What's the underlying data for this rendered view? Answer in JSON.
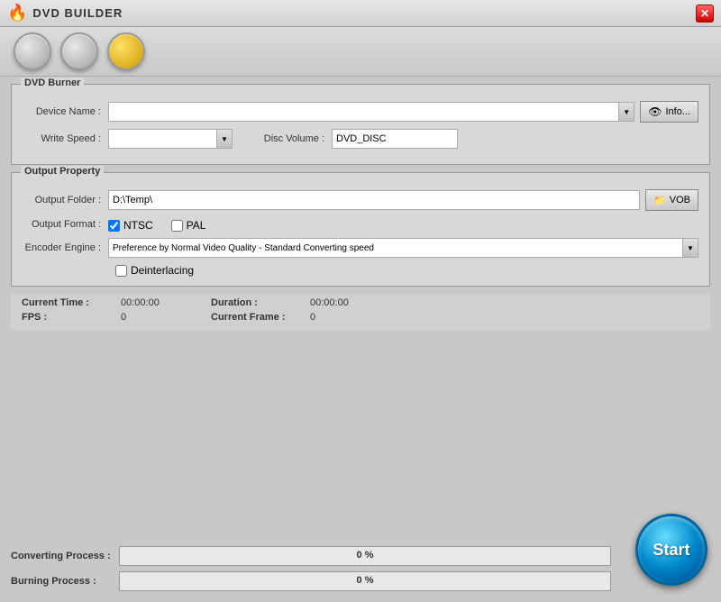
{
  "titleBar": {
    "title": "DVD BUILDER",
    "closeLabel": "✕"
  },
  "toolbar": {
    "btn1": "circle1",
    "btn2": "circle2",
    "btn3": "circle3"
  },
  "dvdBurner": {
    "groupTitle": "DVD Burner",
    "deviceNameLabel": "Device Name :",
    "deviceNameValue": "",
    "infoButtonLabel": "Info...",
    "writeSpeedLabel": "Write Speed :",
    "writeSpeedValue": "",
    "discVolumeLabel": "Disc Volume :",
    "discVolumeValue": "DVD_DISC"
  },
  "outputProperty": {
    "groupTitle": "Output Property",
    "outputFolderLabel": "Output Folder :",
    "outputFolderValue": "D:\\Temp\\",
    "vobButtonLabel": "VOB",
    "outputFormatLabel": "Output Format :",
    "ntscLabel": "NTSC",
    "palLabel": "PAL",
    "encoderEngineLabel": "Encoder Engine :",
    "encoderEngineValue": "Preference by Normal Video Quality - Standard Converting speed",
    "deinterlacingLabel": "Deinterlacing"
  },
  "statusArea": {
    "currentTimeLabel": "Current Time :",
    "currentTimeValue": "00:00:00",
    "durationLabel": "Duration :",
    "durationValue": "00:00:00",
    "fpsLabel": "FPS :",
    "fpsValue": "0",
    "currentFrameLabel": "Current Frame :",
    "currentFrameValue": "0"
  },
  "progressArea": {
    "convertingLabel": "Converting Process :",
    "convertingValue": "0 %",
    "convertingPercent": 0,
    "burningLabel": "Burning Process :",
    "burningValue": "0 %",
    "burningPercent": 0
  },
  "startButton": {
    "label": "Start"
  }
}
